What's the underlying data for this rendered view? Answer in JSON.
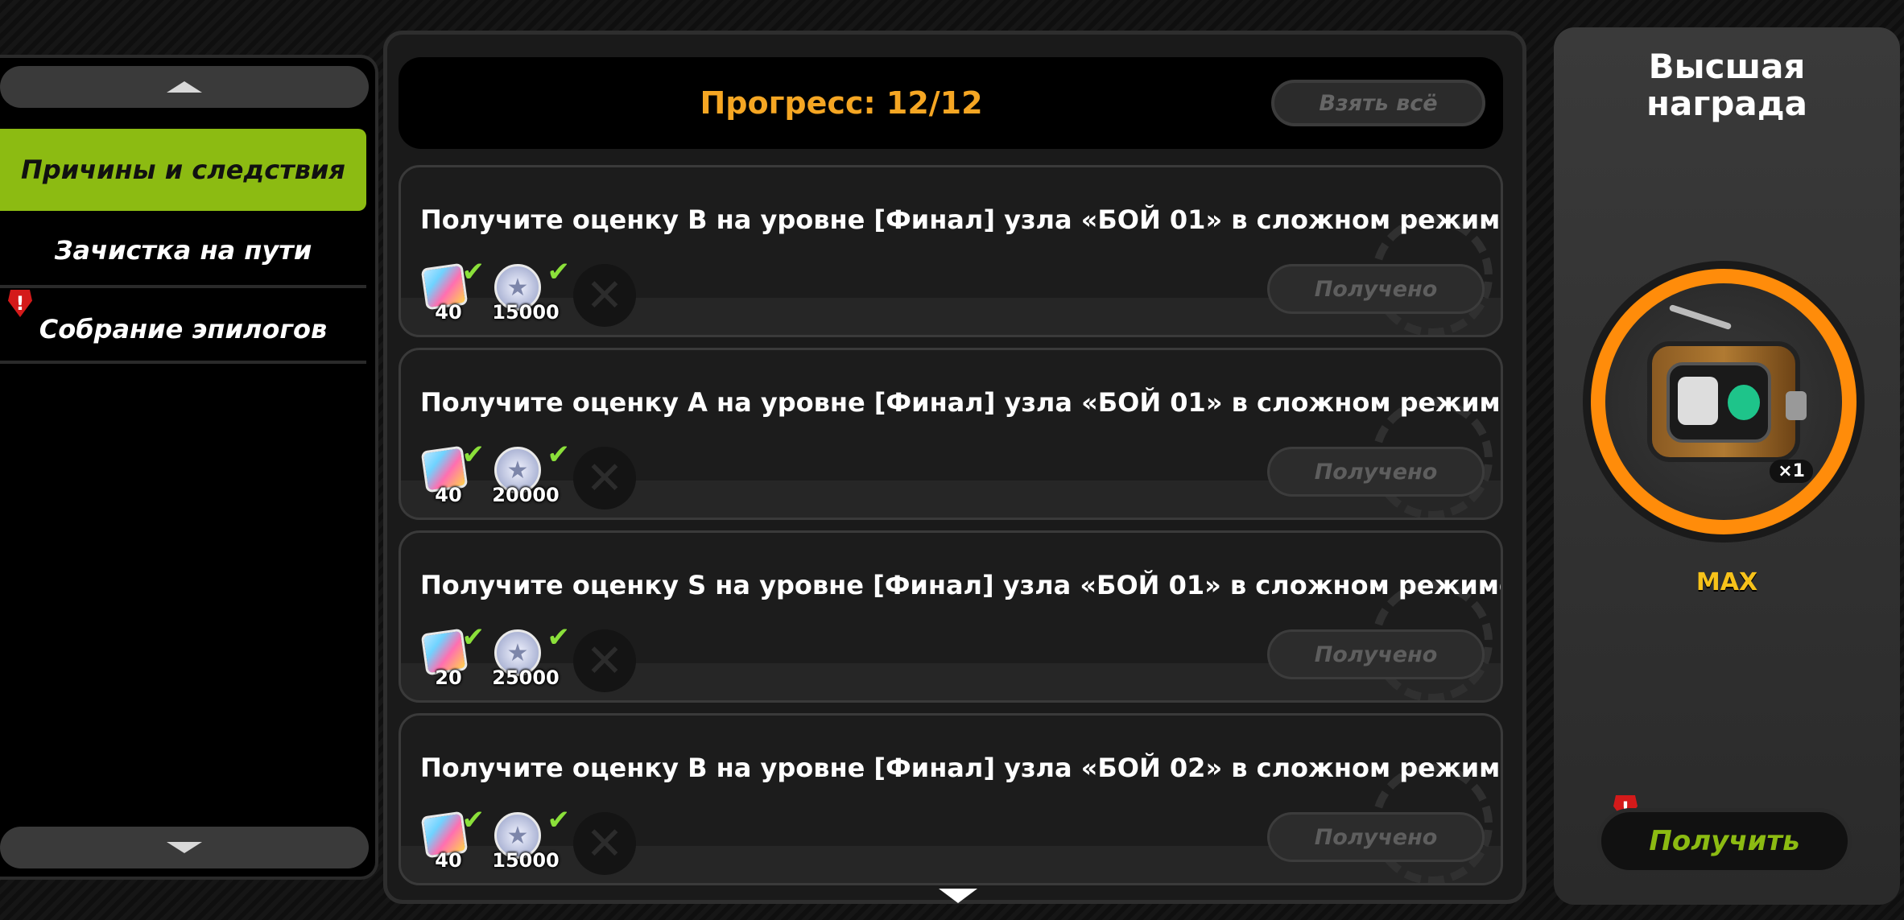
{
  "sidebar": {
    "items": [
      {
        "label": "Причины и следствия",
        "active": true
      },
      {
        "label": "Зачистка на пути",
        "active": false
      },
      {
        "label": "Собрание эпилогов",
        "active": false,
        "alert": "!"
      }
    ]
  },
  "main": {
    "progress_label": "Прогресс: 12/12",
    "take_all_label": "Взять всё",
    "tasks": [
      {
        "title": "Получите оценку B на уровне [Финал] узла «БОЙ 01» в сложном режиме",
        "reward_1": "40",
        "reward_2": "15000",
        "status": "Получено"
      },
      {
        "title": "Получите оценку A на уровне [Финал] узла «БОЙ 01» в сложном режиме",
        "reward_1": "40",
        "reward_2": "20000",
        "status": "Получено"
      },
      {
        "title": "Получите оценку S на уровне [Финал] узла «БОЙ 01» в сложном режиме",
        "reward_1": "20",
        "reward_2": "25000",
        "status": "Получено"
      },
      {
        "title": "Получите оценку B на уровне [Финал] узла «БОЙ 02» в сложном режиме",
        "reward_1": "40",
        "reward_2": "15000",
        "status": "Получено"
      }
    ]
  },
  "top_reward": {
    "title_line1": "Высшая",
    "title_line2": "награда",
    "quantity": "×1",
    "level": "MAX",
    "get_label": "Получить",
    "alert": "!"
  },
  "colors": {
    "accent_green": "#8cbb12",
    "progress_orange": "#f5a623",
    "ring_orange": "#ff8c0a",
    "max_yellow": "#f7c21a",
    "check_green": "#8be03a"
  }
}
